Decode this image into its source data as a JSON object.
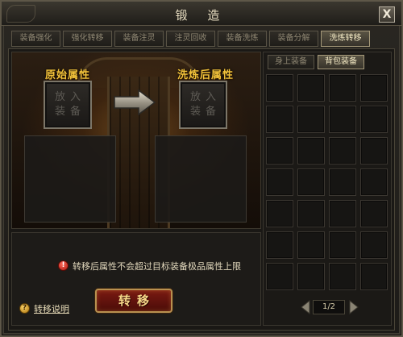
{
  "window": {
    "title": "锻 造",
    "close_label": "X"
  },
  "tabs": [
    {
      "label": "装备强化",
      "active": false
    },
    {
      "label": "强化转移",
      "active": false
    },
    {
      "label": "装备注灵",
      "active": false
    },
    {
      "label": "注灵回收",
      "active": false
    },
    {
      "label": "装备洗炼",
      "active": false
    },
    {
      "label": "装备分解",
      "active": false
    },
    {
      "label": "洗炼转移",
      "active": true
    }
  ],
  "left": {
    "original_title": "原始属性",
    "after_title": "洗炼后属性",
    "slot_placeholder_top": "放入",
    "slot_placeholder_bottom": "装备"
  },
  "notice": {
    "text": "转移后属性不会超过目标装备极品属性上限",
    "icon": "exclamation-icon"
  },
  "actions": {
    "transfer_label": "转移",
    "help_label": "转移说明",
    "help_icon": "question-icon"
  },
  "right": {
    "subtabs": [
      {
        "label": "身上装备",
        "active": false
      },
      {
        "label": "背包装备",
        "active": true
      }
    ],
    "pager": {
      "page": "1/2"
    }
  },
  "colors": {
    "gold_title": "#f2c23a",
    "warning_red": "#c81e12",
    "button_red": "#7a1a12"
  }
}
